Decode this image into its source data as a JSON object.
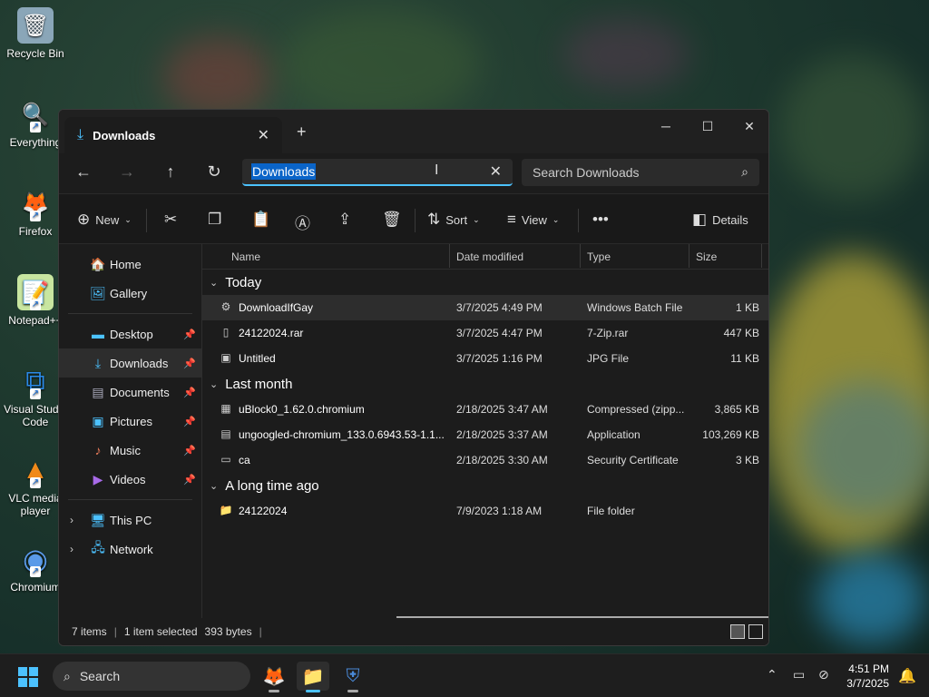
{
  "desktop": {
    "icons": [
      {
        "label": "Recycle Bin",
        "glyph": "🗑"
      },
      {
        "label": "Everything",
        "glyph": "🔍"
      },
      {
        "label": "Firefox",
        "glyph": "🦊"
      },
      {
        "label": "Notepad++",
        "glyph": "📝"
      },
      {
        "label": "Visual Studio Code",
        "glyph": "⧉"
      },
      {
        "label": "VLC media player",
        "glyph": "▲"
      },
      {
        "label": "Chromium",
        "glyph": "◉"
      }
    ]
  },
  "window": {
    "tab_title": "Downloads",
    "tab_icon": "download-icon",
    "address_value": "Downloads",
    "search_placeholder": "Search Downloads",
    "toolbar": {
      "new_label": "New",
      "sort_label": "Sort",
      "view_label": "View",
      "details_label": "Details"
    },
    "sidebar": {
      "top": [
        {
          "label": "Home",
          "glyph": "🏠"
        },
        {
          "label": "Gallery",
          "glyph": "🖼"
        }
      ],
      "pinned": [
        {
          "label": "Desktop",
          "glyph": "▬"
        },
        {
          "label": "Downloads",
          "glyph": "⤓"
        },
        {
          "label": "Documents",
          "glyph": "▤"
        },
        {
          "label": "Pictures",
          "glyph": "▣"
        },
        {
          "label": "Music",
          "glyph": "♪"
        },
        {
          "label": "Videos",
          "glyph": "▶"
        }
      ],
      "tree": [
        {
          "label": "This PC",
          "glyph": "🖥"
        },
        {
          "label": "Network",
          "glyph": "🖧"
        }
      ]
    },
    "columns": {
      "name": "Name",
      "date": "Date modified",
      "type": "Type",
      "size": "Size"
    },
    "groups": [
      {
        "label": "Today",
        "files": [
          {
            "name": "DownloadIfGay",
            "date": "3/7/2025 4:49 PM",
            "type": "Windows Batch File",
            "size": "1 KB",
            "glyph": "⚙"
          },
          {
            "name": "24122024.rar",
            "date": "3/7/2025 4:47 PM",
            "type": "7-Zip.rar",
            "size": "447 KB",
            "glyph": "▯"
          },
          {
            "name": "Untitled",
            "date": "3/7/2025 1:16 PM",
            "type": "JPG File",
            "size": "11 KB",
            "glyph": "▣"
          }
        ]
      },
      {
        "label": "Last month",
        "files": [
          {
            "name": "uBlock0_1.62.0.chromium",
            "date": "2/18/2025 3:47 AM",
            "type": "Compressed (zipp...",
            "size": "3,865 KB",
            "glyph": "▦"
          },
          {
            "name": "ungoogled-chromium_133.0.6943.53-1.1...",
            "date": "2/18/2025 3:37 AM",
            "type": "Application",
            "size": "103,269 KB",
            "glyph": "▤"
          },
          {
            "name": "ca",
            "date": "2/18/2025 3:30 AM",
            "type": "Security Certificate",
            "size": "3 KB",
            "glyph": "▭"
          }
        ]
      },
      {
        "label": "A long time ago",
        "files": [
          {
            "name": "24122024",
            "date": "7/9/2023 1:18 AM",
            "type": "File folder",
            "size": "",
            "glyph": "📁"
          }
        ]
      }
    ],
    "status": {
      "items": "7 items",
      "selected": "1 item selected",
      "bytes": "393 bytes"
    }
  },
  "taskbar": {
    "search_label": "Search",
    "time": "4:51 PM",
    "date": "3/7/2025"
  },
  "colors": {
    "accent": "#4cc2ff",
    "selection": "#0a64c8",
    "window_bg": "#1c1c1c"
  }
}
